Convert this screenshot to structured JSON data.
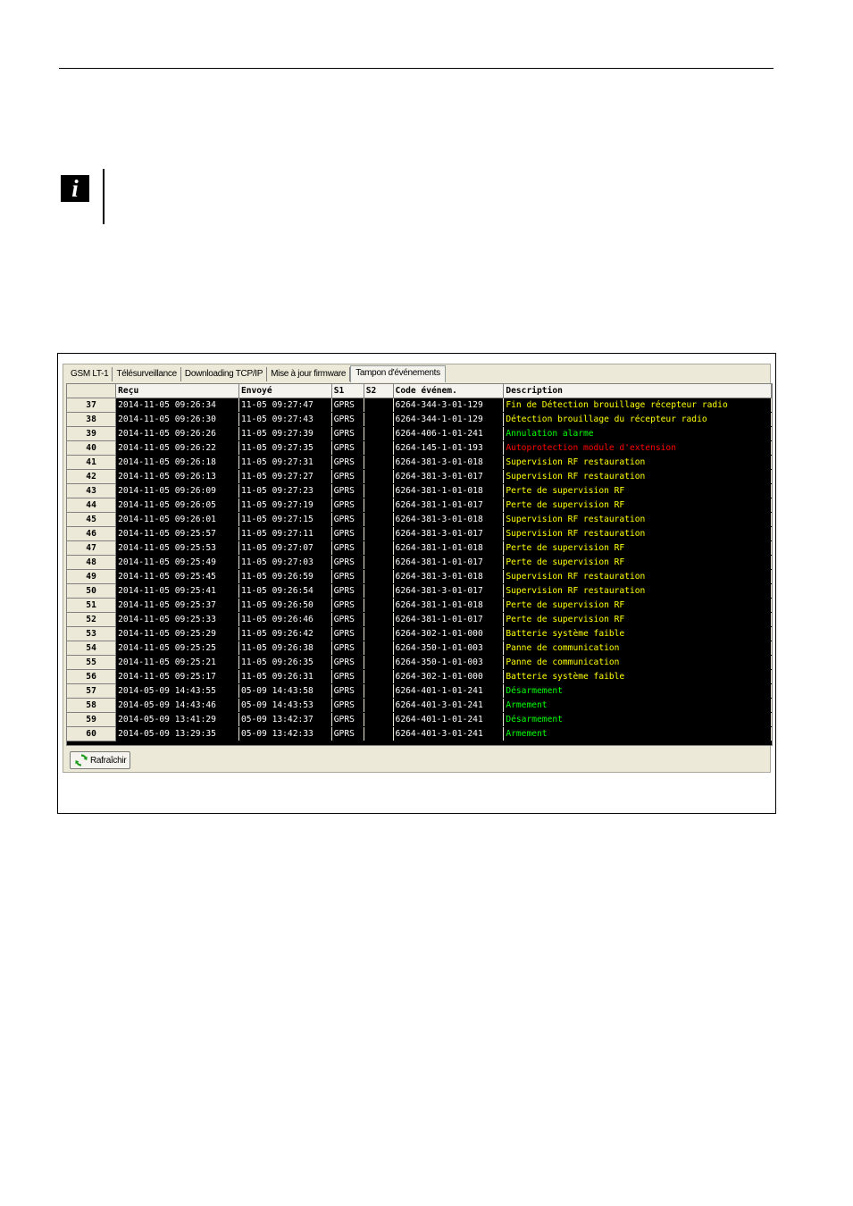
{
  "info": {
    "icon_glyph": "i"
  },
  "tabs": [
    {
      "label": "GSM LT-1",
      "active": false
    },
    {
      "label": "Télésurveillance",
      "active": false
    },
    {
      "label": "Downloading TCP/IP",
      "active": false
    },
    {
      "label": "Mise à jour firmware",
      "active": false
    },
    {
      "label": "Tampon d'événements",
      "active": true
    }
  ],
  "table": {
    "columns": [
      "",
      "Reçu",
      "Envoyé",
      "S1",
      "S2",
      "Code événem.",
      "Description"
    ],
    "rows": [
      {
        "n": "37",
        "recu": "2014-11-05  09:26:34",
        "envoye": "11-05 09:27:47",
        "s1": "GPRS",
        "s2": "",
        "code": "6264-344-3-01-129",
        "desc": "Fin de Détection brouillage récepteur radio",
        "color": "#ffff00"
      },
      {
        "n": "38",
        "recu": "2014-11-05  09:26:30",
        "envoye": "11-05 09:27:43",
        "s1": "GPRS",
        "s2": "",
        "code": "6264-344-1-01-129",
        "desc": "Détection brouillage du récepteur radio",
        "color": "#ffff00"
      },
      {
        "n": "39",
        "recu": "2014-11-05  09:26:26",
        "envoye": "11-05 09:27:39",
        "s1": "GPRS",
        "s2": "",
        "code": "6264-406-1-01-241",
        "desc": "Annulation alarme",
        "color": "#00ff00"
      },
      {
        "n": "40",
        "recu": "2014-11-05  09:26:22",
        "envoye": "11-05 09:27:35",
        "s1": "GPRS",
        "s2": "",
        "code": "6264-145-1-01-193",
        "desc": "Autoprotection module d'extension",
        "color": "#ff0000"
      },
      {
        "n": "41",
        "recu": "2014-11-05  09:26:18",
        "envoye": "11-05 09:27:31",
        "s1": "GPRS",
        "s2": "",
        "code": "6264-381-3-01-018",
        "desc": "Supervision RF restauration",
        "color": "#ffff00"
      },
      {
        "n": "42",
        "recu": "2014-11-05  09:26:13",
        "envoye": "11-05 09:27:27",
        "s1": "GPRS",
        "s2": "",
        "code": "6264-381-3-01-017",
        "desc": "Supervision RF restauration",
        "color": "#ffff00"
      },
      {
        "n": "43",
        "recu": "2014-11-05  09:26:09",
        "envoye": "11-05 09:27:23",
        "s1": "GPRS",
        "s2": "",
        "code": "6264-381-1-01-018",
        "desc": "Perte de supervision RF",
        "color": "#ffff00"
      },
      {
        "n": "44",
        "recu": "2014-11-05  09:26:05",
        "envoye": "11-05 09:27:19",
        "s1": "GPRS",
        "s2": "",
        "code": "6264-381-1-01-017",
        "desc": "Perte de supervision RF",
        "color": "#ffff00"
      },
      {
        "n": "45",
        "recu": "2014-11-05  09:26:01",
        "envoye": "11-05 09:27:15",
        "s1": "GPRS",
        "s2": "",
        "code": "6264-381-3-01-018",
        "desc": "Supervision RF restauration",
        "color": "#ffff00"
      },
      {
        "n": "46",
        "recu": "2014-11-05  09:25:57",
        "envoye": "11-05 09:27:11",
        "s1": "GPRS",
        "s2": "",
        "code": "6264-381-3-01-017",
        "desc": "Supervision RF restauration",
        "color": "#ffff00"
      },
      {
        "n": "47",
        "recu": "2014-11-05  09:25:53",
        "envoye": "11-05 09:27:07",
        "s1": "GPRS",
        "s2": "",
        "code": "6264-381-1-01-018",
        "desc": "Perte de supervision RF",
        "color": "#ffff00"
      },
      {
        "n": "48",
        "recu": "2014-11-05  09:25:49",
        "envoye": "11-05 09:27:03",
        "s1": "GPRS",
        "s2": "",
        "code": "6264-381-1-01-017",
        "desc": "Perte de supervision RF",
        "color": "#ffff00"
      },
      {
        "n": "49",
        "recu": "2014-11-05  09:25:45",
        "envoye": "11-05 09:26:59",
        "s1": "GPRS",
        "s2": "",
        "code": "6264-381-3-01-018",
        "desc": "Supervision RF restauration",
        "color": "#ffff00"
      },
      {
        "n": "50",
        "recu": "2014-11-05  09:25:41",
        "envoye": "11-05 09:26:54",
        "s1": "GPRS",
        "s2": "",
        "code": "6264-381-3-01-017",
        "desc": "Supervision RF restauration",
        "color": "#ffff00"
      },
      {
        "n": "51",
        "recu": "2014-11-05  09:25:37",
        "envoye": "11-05 09:26:50",
        "s1": "GPRS",
        "s2": "",
        "code": "6264-381-1-01-018",
        "desc": "Perte de supervision RF",
        "color": "#ffff00"
      },
      {
        "n": "52",
        "recu": "2014-11-05  09:25:33",
        "envoye": "11-05 09:26:46",
        "s1": "GPRS",
        "s2": "",
        "code": "6264-381-1-01-017",
        "desc": "Perte de supervision RF",
        "color": "#ffff00"
      },
      {
        "n": "53",
        "recu": "2014-11-05  09:25:29",
        "envoye": "11-05 09:26:42",
        "s1": "GPRS",
        "s2": "",
        "code": "6264-302-1-01-000",
        "desc": "Batterie système faible",
        "color": "#ffff00"
      },
      {
        "n": "54",
        "recu": "2014-11-05  09:25:25",
        "envoye": "11-05 09:26:38",
        "s1": "GPRS",
        "s2": "",
        "code": "6264-350-1-01-003",
        "desc": "Panne de communication",
        "color": "#ffff00"
      },
      {
        "n": "55",
        "recu": "2014-11-05  09:25:21",
        "envoye": "11-05 09:26:35",
        "s1": "GPRS",
        "s2": "",
        "code": "6264-350-1-01-003",
        "desc": "Panne de communication",
        "color": "#ffff00"
      },
      {
        "n": "56",
        "recu": "2014-11-05  09:25:17",
        "envoye": "11-05 09:26:31",
        "s1": "GPRS",
        "s2": "",
        "code": "6264-302-1-01-000",
        "desc": "Batterie système faible",
        "color": "#ffff00"
      },
      {
        "n": "57",
        "recu": "2014-05-09  14:43:55",
        "envoye": "05-09 14:43:58",
        "s1": "GPRS",
        "s2": "",
        "code": "6264-401-1-01-241",
        "desc": "Désarmement",
        "color": "#00ff00"
      },
      {
        "n": "58",
        "recu": "2014-05-09  14:43:46",
        "envoye": "05-09 14:43:53",
        "s1": "GPRS",
        "s2": "",
        "code": "6264-401-3-01-241",
        "desc": "Armement",
        "color": "#00ff00"
      },
      {
        "n": "59",
        "recu": "2014-05-09  13:41:29",
        "envoye": "05-09 13:42:37",
        "s1": "GPRS",
        "s2": "",
        "code": "6264-401-1-01-241",
        "desc": "Désarmement",
        "color": "#00ff00"
      },
      {
        "n": "60",
        "recu": "2014-05-09  13:29:35",
        "envoye": "05-09 13:42:33",
        "s1": "GPRS",
        "s2": "",
        "code": "6264-401-3-01-241",
        "desc": "Armement",
        "color": "#00ff00"
      }
    ]
  },
  "refresh_button": {
    "label": "Rafraîchir",
    "icon": "refresh-icon"
  }
}
